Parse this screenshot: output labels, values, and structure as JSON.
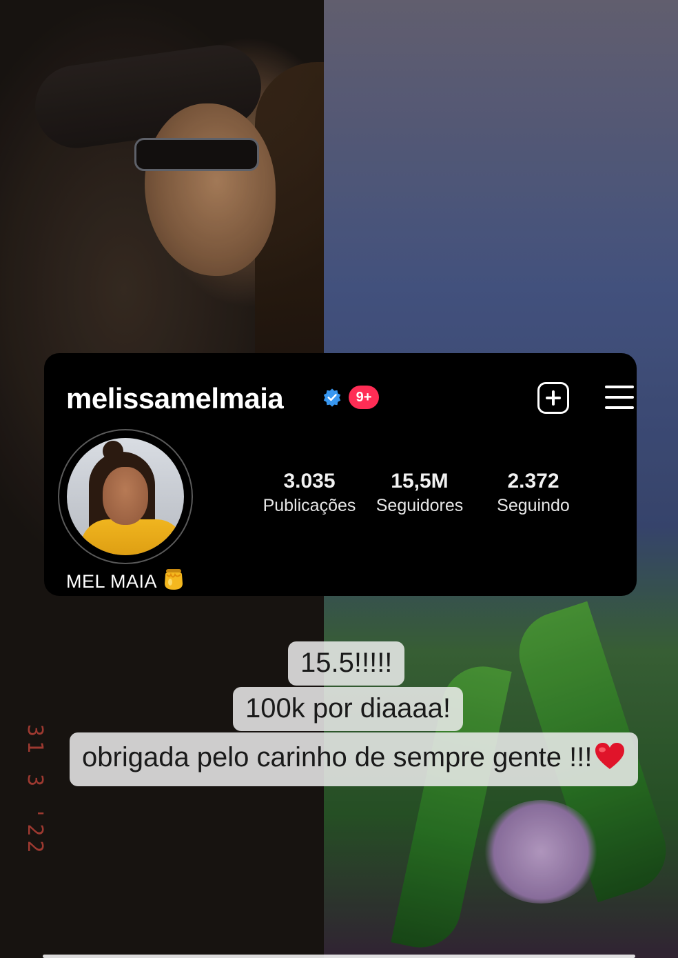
{
  "profile": {
    "username": "melissamelmaia",
    "verified": true,
    "notification_badge": "9+",
    "display_name": "MEL MAIA",
    "display_name_emoji": "honey-pot-icon",
    "stats": [
      {
        "value": "3.035",
        "label": "Publicações"
      },
      {
        "value": "15,5M",
        "label": "Seguidores"
      },
      {
        "value": "2.372",
        "label": "Seguindo"
      }
    ],
    "actions": {
      "create": "plus-square-icon",
      "menu": "hamburger-menu-icon"
    }
  },
  "story": {
    "captions": [
      "15.5!!!!!",
      "100k por diaaaa!",
      "obrigada pelo carinho de sempre gente !!!"
    ],
    "caption_emoji": "red-heart-icon",
    "photo_date_stamp": "31 3 '22"
  },
  "colors": {
    "card_bg": "#000000",
    "verified_blue": "#3897f0",
    "badge_red": "#ff2d55",
    "caption_bg": "#ececec"
  }
}
